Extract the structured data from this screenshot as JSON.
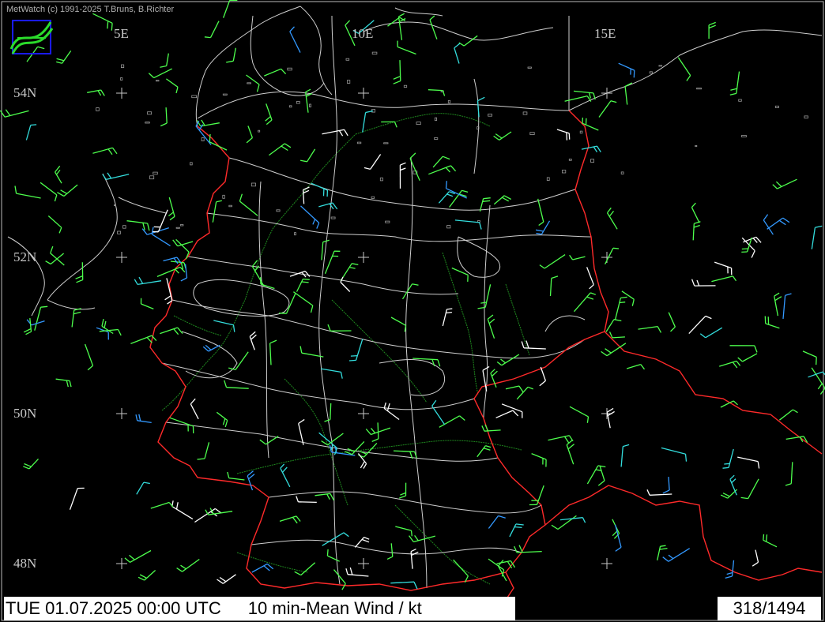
{
  "credit": "MetWatch  (c) 1991-2025 T.Bruns, B.Richter",
  "lon_labels": [
    "5E",
    "10E",
    "15E"
  ],
  "lat_labels": [
    "54N",
    "52N",
    "50N",
    "48N"
  ],
  "status": {
    "datetime": "TUE 01.07.2025 00:00 UTC",
    "product": "10 min-Mean Wind / kt",
    "frame": "318/1494"
  },
  "colors": {
    "background": "#000000",
    "border_lines": "#d0d0d0",
    "national_border": "#ff2020",
    "rivers": "#1f8a1f",
    "wind_light": "#4dff4d",
    "wind_moderate": "#ffffff",
    "wind_calm": "#3399ff",
    "wind_cyan": "#33dddd"
  },
  "icons": [
    "metwatch-logo-icon",
    "grid-cross-icon"
  ]
}
